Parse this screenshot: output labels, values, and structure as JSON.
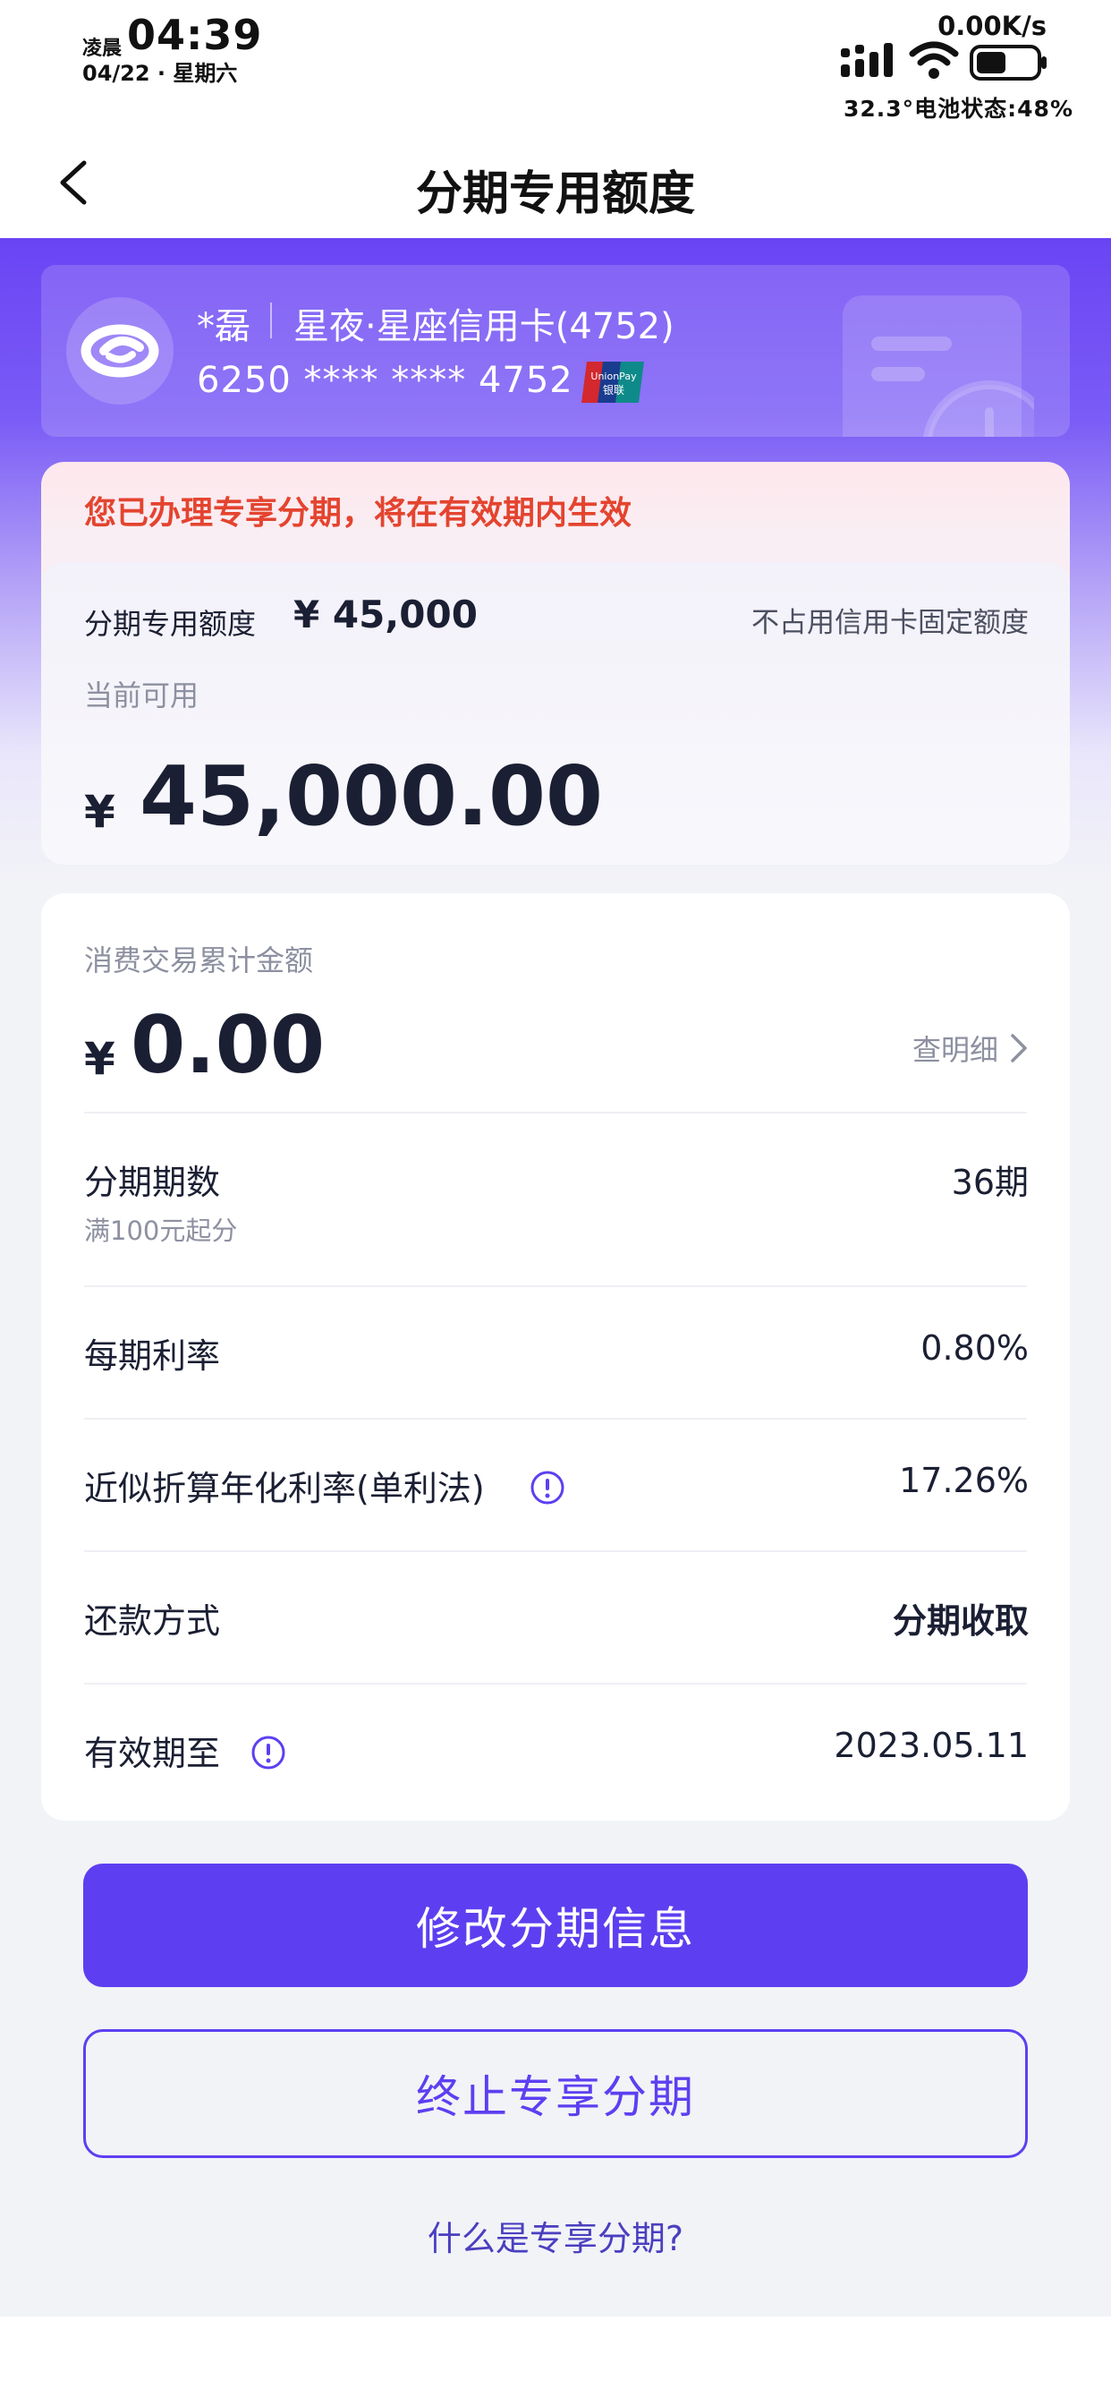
{
  "status_bar": {
    "ampm": "凌晨",
    "time": "04:39",
    "date": "04/22 · 星期六",
    "net_speed": "0.00K/s",
    "battery_text": "32.3°电池状态:48%",
    "battery_level_percent": 48
  },
  "header": {
    "title": "分期专用额度",
    "back_icon": "chevron-left-icon"
  },
  "card": {
    "owner": "*磊",
    "name": "星夜·星座信用卡(4752)",
    "number": "6250 **** **** 4752",
    "logo_icon": "bank-logo-icon",
    "network_logo": "unionpay-logo",
    "network_logo_text_top": "UnionPay",
    "network_logo_text_bottom": "银联"
  },
  "notice": {
    "text": "您已办理专享分期，将在有效期内生效"
  },
  "quota": {
    "label": "分期专用额度",
    "amount": "¥ 45,000",
    "note": "不占用信用卡固定额度",
    "available_label": "当前可用",
    "available_currency": "¥",
    "available_amount": "45,000.00"
  },
  "details": {
    "cumulative_label": "消费交易累计金额",
    "cumulative_currency": "¥",
    "cumulative_amount": "0.00",
    "detail_link": "查明细",
    "rows": [
      {
        "label": "分期期数",
        "sub": "满100元起分",
        "value": "36期"
      },
      {
        "label": "每期利率",
        "value": "0.80%"
      },
      {
        "label": "近似折算年化利率(单利法)",
        "value": "17.26%",
        "icon": "info-icon"
      },
      {
        "label": "还款方式",
        "value": "分期收取"
      },
      {
        "label": "有效期至",
        "value": "2023.05.11",
        "icon": "info-icon"
      }
    ]
  },
  "actions": {
    "modify": "修改分期信息",
    "terminate": "终止专享分期",
    "faq": "什么是专享分期?"
  },
  "colors": {
    "primary": "#5d3ff1",
    "notice_red": "#e4442f",
    "hero_purple": "#6a44f4"
  }
}
